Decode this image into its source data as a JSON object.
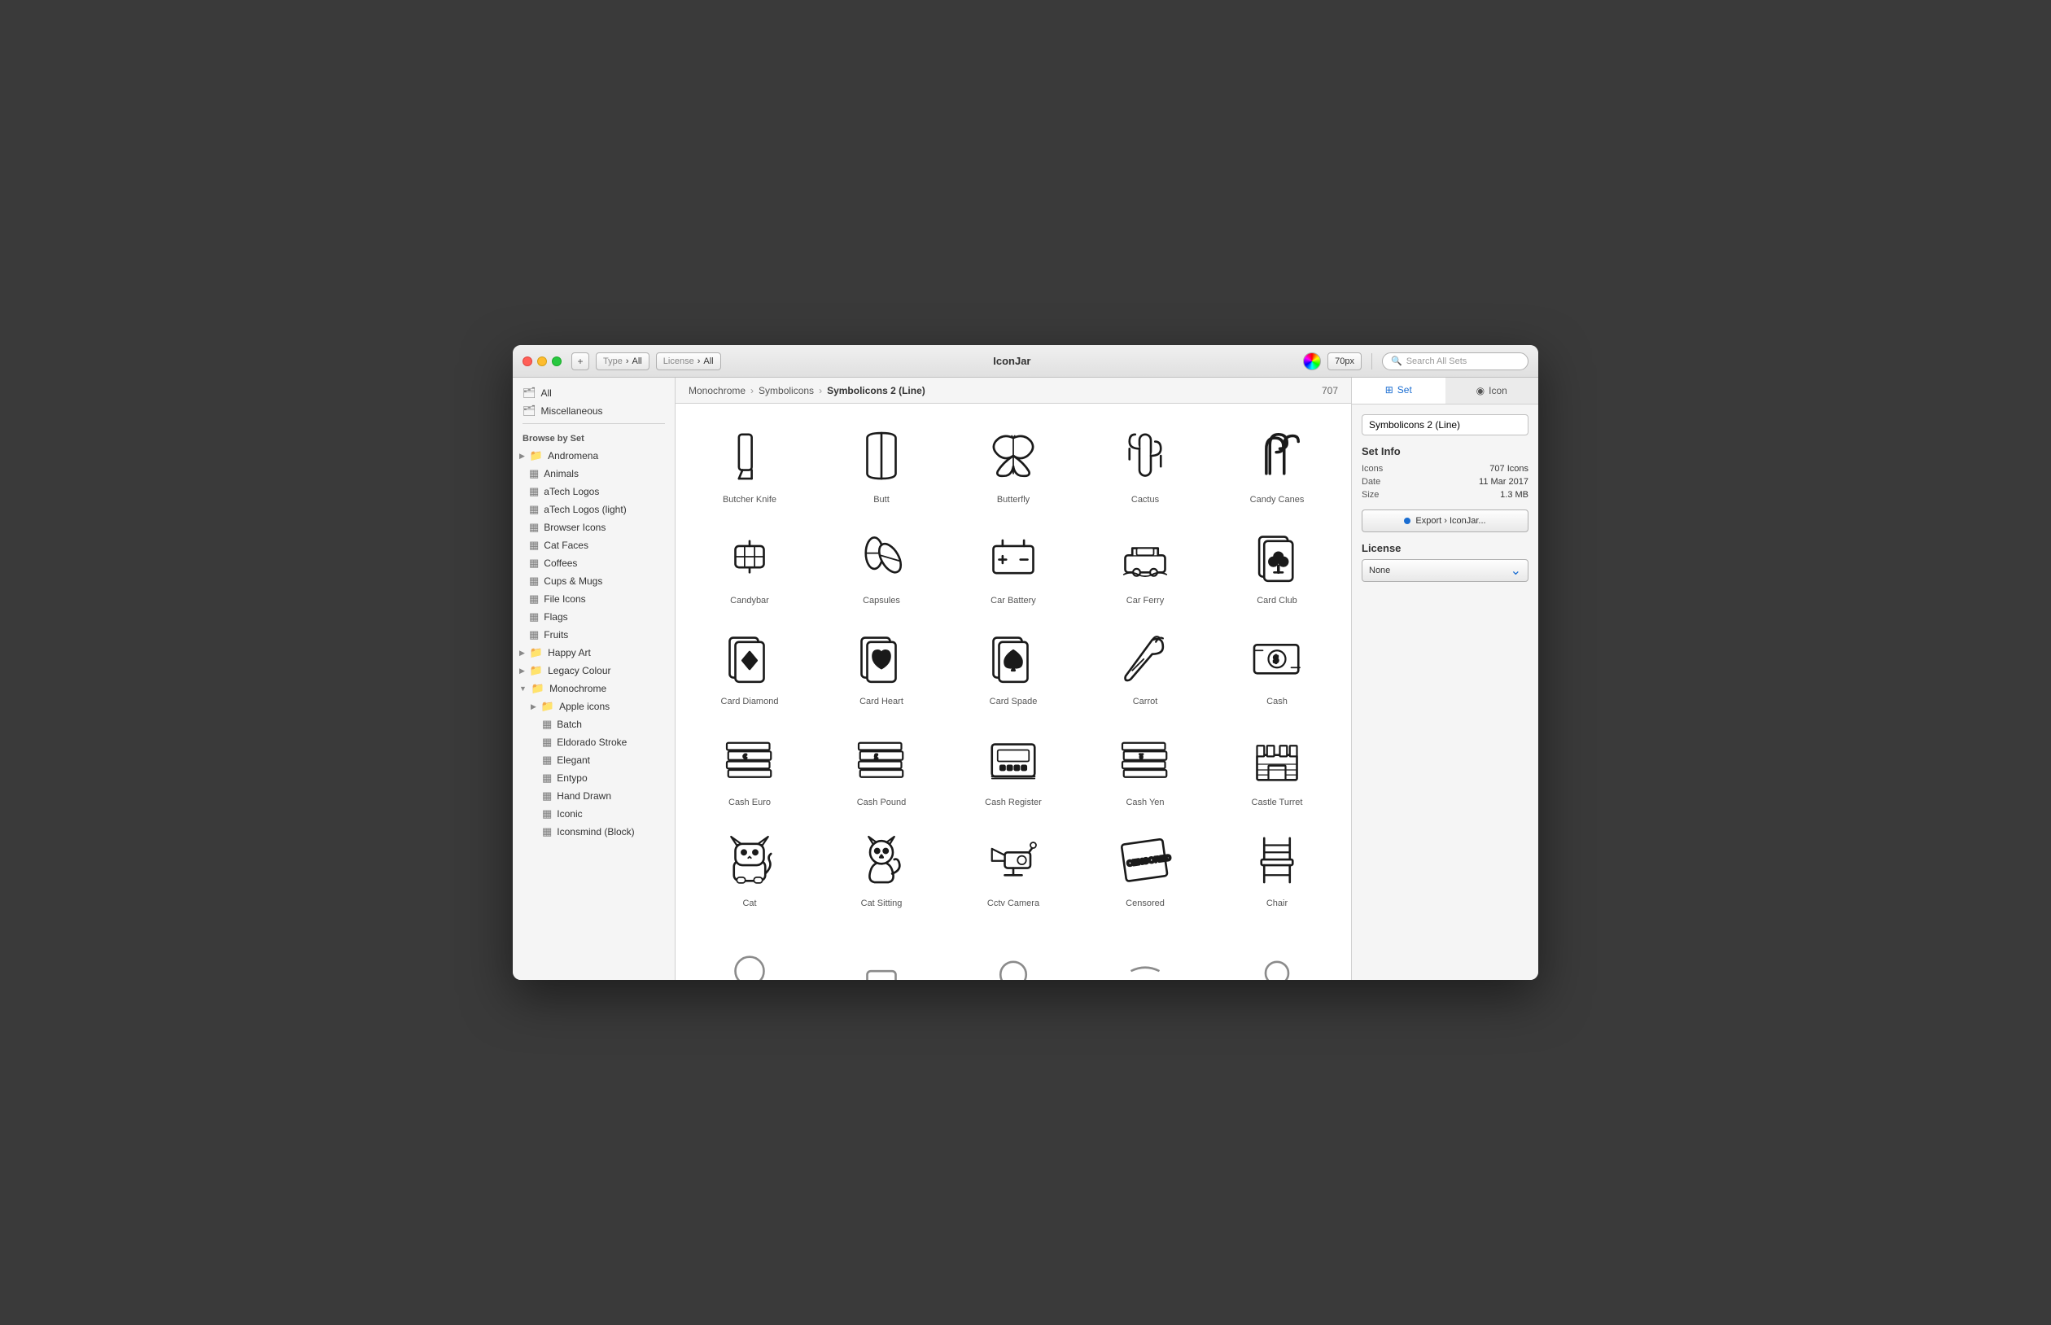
{
  "window": {
    "title": "IconJar"
  },
  "titlebar": {
    "add_btn": "+",
    "type_label": "Type",
    "type_value": "All",
    "license_label": "License",
    "license_value": "All",
    "px_value": "70px",
    "search_placeholder": "Search All Sets"
  },
  "sidebar": {
    "all_label": "All",
    "misc_label": "Miscellaneous",
    "browse_label": "Browse by Set",
    "items": [
      {
        "label": "Andromena",
        "indent": 1,
        "arrow": true,
        "type": "folder"
      },
      {
        "label": "Animals",
        "indent": 1,
        "type": "set"
      },
      {
        "label": "aTech Logos",
        "indent": 1,
        "type": "set"
      },
      {
        "label": "aTech Logos (light)",
        "indent": 1,
        "type": "set"
      },
      {
        "label": "Browser Icons",
        "indent": 1,
        "type": "set"
      },
      {
        "label": "Cat Faces",
        "indent": 1,
        "type": "set"
      },
      {
        "label": "Coffees",
        "indent": 1,
        "type": "set"
      },
      {
        "label": "Cups & Mugs",
        "indent": 1,
        "type": "set"
      },
      {
        "label": "File Icons",
        "indent": 1,
        "type": "set"
      },
      {
        "label": "Flags",
        "indent": 1,
        "type": "set"
      },
      {
        "label": "Fruits",
        "indent": 1,
        "type": "set"
      },
      {
        "label": "Happy Art",
        "indent": 1,
        "arrow": true,
        "type": "folder"
      },
      {
        "label": "Legacy Colour",
        "indent": 1,
        "arrow": true,
        "type": "folder"
      },
      {
        "label": "Monochrome",
        "indent": 1,
        "arrow_down": true,
        "type": "folder"
      },
      {
        "label": "Apple icons",
        "indent": 2,
        "arrow": true,
        "type": "folder"
      },
      {
        "label": "Batch",
        "indent": 2,
        "type": "set"
      },
      {
        "label": "Eldorado Stroke",
        "indent": 2,
        "type": "set"
      },
      {
        "label": "Elegant",
        "indent": 2,
        "type": "set"
      },
      {
        "label": "Entypo",
        "indent": 2,
        "type": "set"
      },
      {
        "label": "Hand Drawn",
        "indent": 2,
        "type": "set"
      },
      {
        "label": "Iconic",
        "indent": 2,
        "type": "set"
      },
      {
        "label": "Iconsmind (Block)",
        "indent": 2,
        "type": "set"
      }
    ]
  },
  "breadcrumb": {
    "items": [
      "Monochrome",
      "Symbolicons",
      "Symbolicons 2 (Line)"
    ],
    "count": "707"
  },
  "icons": [
    {
      "name": "Butcher Knife",
      "svg_id": "butcher-knife"
    },
    {
      "name": "Butt",
      "svg_id": "butt"
    },
    {
      "name": "Butterfly",
      "svg_id": "butterfly"
    },
    {
      "name": "Cactus",
      "svg_id": "cactus"
    },
    {
      "name": "Candy Canes",
      "svg_id": "candy-canes"
    },
    {
      "name": "Candybar",
      "svg_id": "candybar"
    },
    {
      "name": "Capsules",
      "svg_id": "capsules"
    },
    {
      "name": "Car Battery",
      "svg_id": "car-battery"
    },
    {
      "name": "Car Ferry",
      "svg_id": "car-ferry"
    },
    {
      "name": "Card Club",
      "svg_id": "card-club"
    },
    {
      "name": "Card Diamond",
      "svg_id": "card-diamond"
    },
    {
      "name": "Card Heart",
      "svg_id": "card-heart"
    },
    {
      "name": "Card Spade",
      "svg_id": "card-spade"
    },
    {
      "name": "Carrot",
      "svg_id": "carrot"
    },
    {
      "name": "Cash",
      "svg_id": "cash"
    },
    {
      "name": "Cash Euro",
      "svg_id": "cash-euro"
    },
    {
      "name": "Cash Pound",
      "svg_id": "cash-pound"
    },
    {
      "name": "Cash Register",
      "svg_id": "cash-register"
    },
    {
      "name": "Cash Yen",
      "svg_id": "cash-yen"
    },
    {
      "name": "Castle Turret",
      "svg_id": "castle-turret"
    },
    {
      "name": "Cat",
      "svg_id": "cat"
    },
    {
      "name": "Cat Sitting",
      "svg_id": "cat-sitting"
    },
    {
      "name": "Cctv Camera",
      "svg_id": "cctv-camera"
    },
    {
      "name": "Censored",
      "svg_id": "censored"
    },
    {
      "name": "Chair",
      "svg_id": "chair"
    }
  ],
  "right_panel": {
    "tab_set": "Set",
    "tab_icon": "Icon",
    "set_name": "Symbolicons 2 (Line)",
    "set_info_title": "Set Info",
    "icons_label": "Icons",
    "icons_value": "707 Icons",
    "date_label": "Date",
    "date_value": "11 Mar 2017",
    "size_label": "Size",
    "size_value": "1.3 MB",
    "export_btn": "Export › IconJar...",
    "license_title": "License",
    "license_value": "None"
  }
}
